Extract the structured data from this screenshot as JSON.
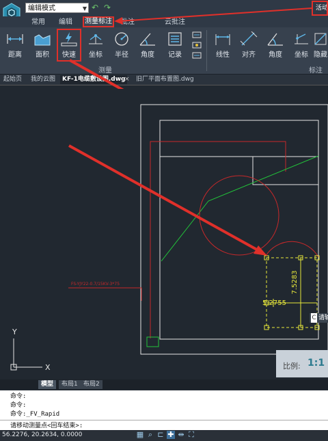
{
  "titlebar": {
    "mode": "编辑模式",
    "right_text": "活动"
  },
  "tabs": [
    "常用",
    "编辑",
    "测量标注",
    "批注",
    "云批注"
  ],
  "ribbon": {
    "measure_buttons": [
      "距离",
      "面积",
      "快速",
      "坐标",
      "半径",
      "角度",
      "记录"
    ],
    "annotate_buttons": [
      "线性",
      "对齐",
      "角度",
      "坐标",
      "隐藏"
    ],
    "group_measure": "测量",
    "group_annotate": "标注"
  },
  "doc_tabs": [
    "起始页",
    "我的云图",
    "KF-1电缆敷设图.dwg",
    "旧厂平面布置图.dwg"
  ],
  "canvas": {
    "dim_vertical": "7.5283",
    "dim_horizontal": "5.2755",
    "cable_label": "FS-YJY22-0.7/15KV-3*75",
    "ucs_y": "Y",
    "ucs_x": "X",
    "side_tip_icon": "C",
    "side_tip_text": "请输",
    "scale_label": "比例:",
    "scale_value": "1:1"
  },
  "layout_tabs": [
    "模型",
    "布局1",
    "布局2"
  ],
  "command": {
    "history": [
      "命令:",
      "命令:",
      "命令:_FV_Rapid"
    ],
    "prompt": "请移动测量点<回车结束>:"
  },
  "status": {
    "coords": "56.2276, 20.2634, 0.0000"
  },
  "colors": {
    "accent_red": "#e0302a",
    "drawing_white": "#e6e6e6",
    "drawing_green": "#22c33a",
    "drawing_yellow": "#e8e83a",
    "drawing_red": "#c8282a"
  }
}
